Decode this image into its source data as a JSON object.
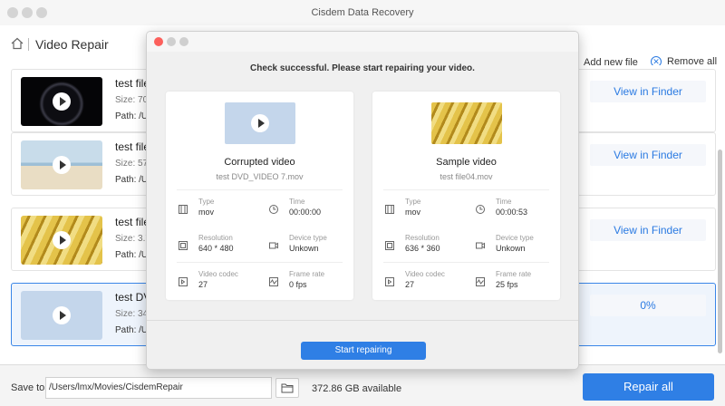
{
  "window": {
    "title": "Cisdem Data Recovery"
  },
  "header": {
    "title": "Video Repair",
    "add_file": "Add new file",
    "remove_all": "Remove all"
  },
  "rows": [
    {
      "name": "test file",
      "size": "Size: 705",
      "path": "Path: /U",
      "action": "View in Finder"
    },
    {
      "name": "test file",
      "size": "Size: 574",
      "path": "Path: /U",
      "action": "View in Finder"
    },
    {
      "name": "test file",
      "size": "Size: 3.7",
      "path": "Path: /U",
      "action": "View in Finder"
    },
    {
      "name": "test DV",
      "size": "Size: 34",
      "path": "Path: /U",
      "action": "0%"
    }
  ],
  "footer": {
    "save_label": "Save to:",
    "save_path": "/Users/lmx/Movies/CisdemRepair",
    "available": "372.86 GB available",
    "repair_all": "Repair all"
  },
  "dialog": {
    "status": "Check successful. Please start repairing your video.",
    "start_button": "Start repairing",
    "corrupted": {
      "title": "Corrupted video",
      "filename": "test DVD_VIDEO 7.mov",
      "type_label": "Type",
      "type": "mov",
      "time_label": "Time",
      "time": "00:00:00",
      "resolution_label": "Resolution",
      "resolution": "640 * 480",
      "device_label": "Device type",
      "device": "Unkown",
      "codec_label": "Video codec",
      "codec": "27",
      "framerate_label": "Frame rate",
      "framerate": "0 fps"
    },
    "sample": {
      "title": "Sample video",
      "filename": "test file04.mov",
      "type_label": "Type",
      "type": "mov",
      "time_label": "Time",
      "time": "00:00:53",
      "resolution_label": "Resolution",
      "resolution": "636 * 360",
      "device_label": "Device type",
      "device": "Unkown",
      "codec_label": "Video codec",
      "codec": "27",
      "framerate_label": "Frame rate",
      "framerate": "25 fps"
    }
  },
  "colors": {
    "accent": "#2f7fe5",
    "close": "#fc605c"
  }
}
